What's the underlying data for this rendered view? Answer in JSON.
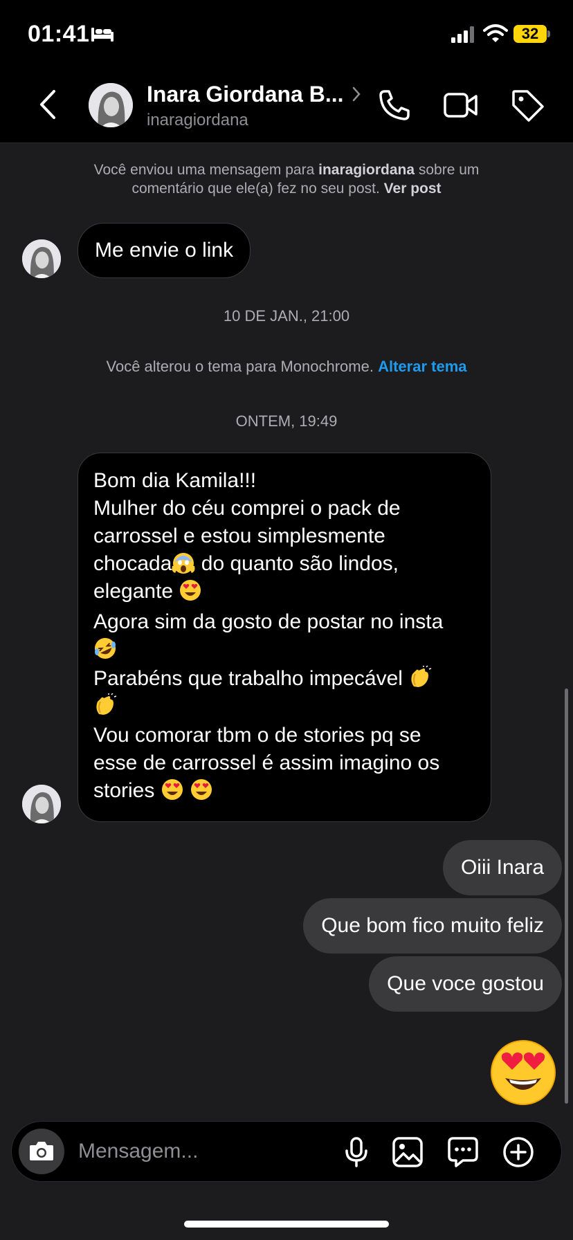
{
  "status_bar": {
    "time": "01:41",
    "battery": "32"
  },
  "header": {
    "contact_name": "Inara Giordana B...",
    "username": "inaragiordana",
    "icons": [
      "back-icon",
      "chevron-right-icon",
      "phone-icon",
      "video-icon",
      "tag-icon"
    ]
  },
  "messages": {
    "system_comment": {
      "prefix": "Você enviou uma mensagem para",
      "user": "inaragiordana",
      "middle": "sobre um comentário que ele(a) fez no seu post.",
      "link": "Ver post"
    },
    "incoming_1": "Me envie o link",
    "timestamp_1": "10 DE JAN., 21:00",
    "system_theme": {
      "text": "Você alterou o tema para Monochrome.",
      "link": "Alterar tema"
    },
    "timestamp_2": "ONTEM, 19:49",
    "incoming_2": {
      "l1": "Bom dia Kamila!!!",
      "l2": "Mulher do céu comprei o pack de",
      "l3": "carrossel e estou simplesmente",
      "l4a": "chocada",
      "l4b": " do quanto são lindos,",
      "l5": "elegante ",
      "l6": "Agora sim da gosto de postar no insta",
      "l8": "Parabéns que trabalho impecável ",
      "l10": "Vou comorar tbm o de stories pq se",
      "l11": "esse de carrossel é assim imagino os",
      "l12": "stories "
    },
    "outgoing": [
      "Oiii Inara",
      "Que bom fico muito feliz",
      "Que voce gostou"
    ]
  },
  "composer": {
    "placeholder": "Mensagem...",
    "icons": [
      "camera-icon",
      "microphone-icon",
      "image-icon",
      "sticker-icon",
      "plus-icon"
    ]
  },
  "colors": {
    "accent": "#1d9bf0",
    "battery": "#ffd60a",
    "bubble_out": "#3a3a3c",
    "bg": "#1c1c1e"
  }
}
